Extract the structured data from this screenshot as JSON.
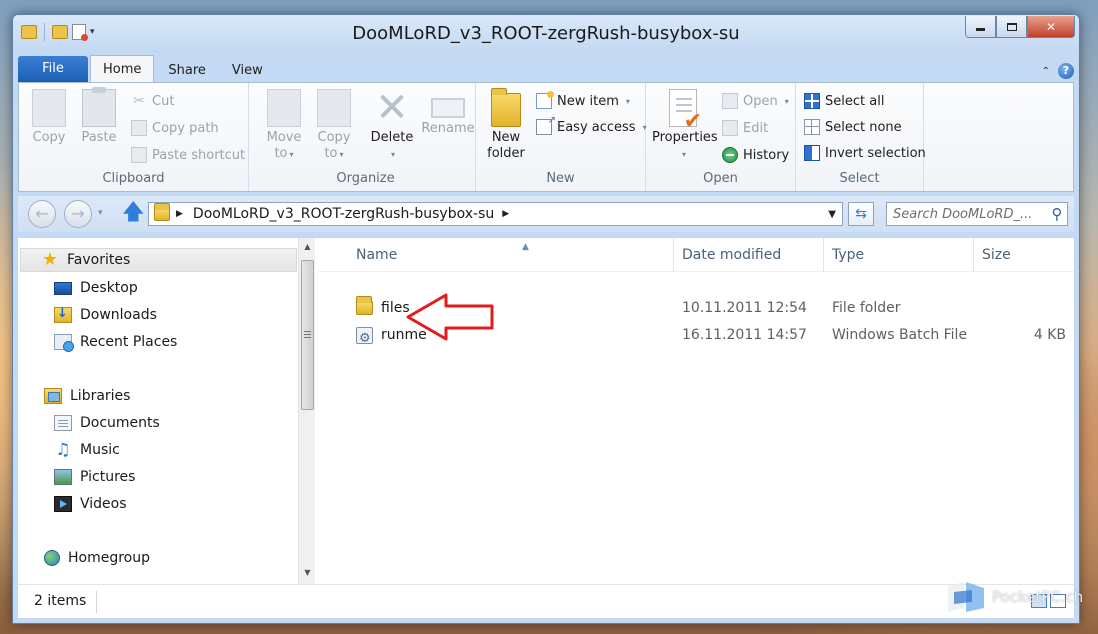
{
  "window": {
    "title": "DooMLoRD_v3_ROOT-zergRush-busybox-su",
    "controls": {
      "minimize": "",
      "maximize": "",
      "close": "✕"
    }
  },
  "ribbon": {
    "tabs": [
      "File",
      "Home",
      "Share",
      "View"
    ],
    "active_tab": "Home",
    "groups": {
      "clipboard": {
        "label": "Clipboard",
        "copy": "Copy",
        "paste": "Paste",
        "cut": "Cut",
        "copy_path": "Copy path",
        "paste_shortcut": "Paste shortcut"
      },
      "organize": {
        "label": "Organize",
        "move_to": [
          "Move",
          "to"
        ],
        "copy_to": [
          "Copy",
          "to"
        ],
        "delete": "Delete",
        "rename": "Rename"
      },
      "new": {
        "label": "New",
        "new_folder": [
          "New",
          "folder"
        ],
        "new_item": "New item",
        "easy_access": "Easy access"
      },
      "open": {
        "label": "Open",
        "properties": "Properties",
        "open": "Open",
        "edit": "Edit",
        "history": "History"
      },
      "select": {
        "label": "Select",
        "select_all": "Select all",
        "select_none": "Select none",
        "invert_selection": "Invert selection"
      }
    }
  },
  "address": {
    "path": "DooMLoRD_v3_ROOT-zergRush-busybox-su",
    "search_placeholder": "Search DooMLoRD_..."
  },
  "nav_pane": {
    "favorites": "Favorites",
    "desktop": "Desktop",
    "downloads": "Downloads",
    "recent_places": "Recent Places",
    "libraries": "Libraries",
    "documents": "Documents",
    "music": "Music",
    "pictures": "Pictures",
    "videos": "Videos",
    "homegroup": "Homegroup"
  },
  "file_list": {
    "columns": [
      "Name",
      "Date modified",
      "Type",
      "Size"
    ],
    "rows": [
      {
        "name": "files",
        "date": "10.11.2011 12:54",
        "type": "File folder",
        "size": ""
      },
      {
        "name": "runme",
        "date": "16.11.2011 14:57",
        "type": "Windows Batch File",
        "size": "4 KB"
      }
    ]
  },
  "status": {
    "items_count": "2 items"
  },
  "watermark": {
    "text": "PocketPC.ch"
  },
  "colors": {
    "accent": "#2d73cf",
    "file_tab": "#1c5db4",
    "arrow": "#e31b1b"
  }
}
